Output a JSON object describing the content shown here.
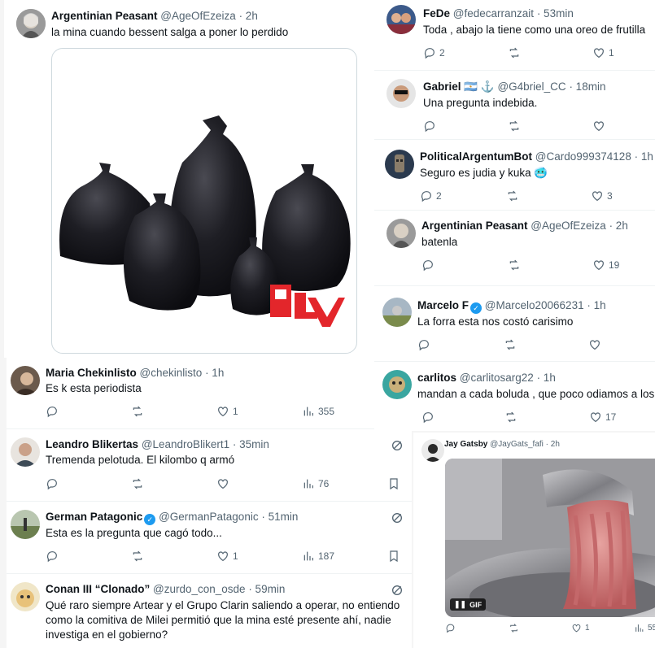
{
  "colors": {
    "text": "#0f1419",
    "muted": "#536471",
    "accent": "#1d9bf0",
    "bag": "#1b1b1f",
    "logo_red": "#e3262b"
  },
  "main": {
    "name": "Argentinian Peasant",
    "handle": "@AgeOfEzeiza",
    "time": "· 2h",
    "text": "la mina cuando bessent salga a poner lo perdido",
    "image_alt": "black garbage bags"
  },
  "left_replies": [
    {
      "name": "Maria Chekinlisto",
      "handle": "@chekinlisto",
      "time": "· 1h",
      "text": "Es k esta periodista",
      "likes": "1",
      "views": "355"
    },
    {
      "name": "Leandro Blikertas",
      "handle": "@LeandroBlikert1",
      "time": "· 35min",
      "text": "Tremenda pelotuda. El kilombo q armó",
      "likes": "",
      "views": "76"
    },
    {
      "name": "German Patagonic",
      "handle": "@GermanPatagonic",
      "time": "· 51min",
      "text": "Esta es la pregunta que cagó todo...",
      "likes": "1",
      "views": "187"
    },
    {
      "name": "Conan III “Clonado”",
      "handle": "@zurdo_con_osde",
      "time": "· 59min",
      "text": "Qué raro siempre Artear y el Grupo Clarin saliendo a operar, no entiendo como la comitiva de Milei permitió que la mina esté presente ahí, nadie investiga en el gobierno?"
    }
  ],
  "right_replies": [
    {
      "name": "FeDe",
      "handle": "@fedecarranzait",
      "time": "· 53min",
      "text": "Toda , abajo la tiene como una oreo de frutilla",
      "replies": "2",
      "likes": "1"
    },
    {
      "name": "Gabriel",
      "flags": "🇦🇷 ⚓",
      "handle": "@G4briel_CC",
      "time": "· 18min",
      "text": "Una pregunta indebida.",
      "replies": "",
      "likes": ""
    },
    {
      "name": "PoliticalArgentumBot",
      "handle": "@Cardo999374128",
      "time": "· 1h",
      "text": "Seguro es judia y kuka",
      "emoji": "🥶",
      "replies": "2",
      "likes": "3"
    },
    {
      "name": "Argentinian Peasant",
      "handle": "@AgeOfEzeiza",
      "time": "· 2h",
      "text": "batenla",
      "replies": "",
      "likes": "19"
    },
    {
      "name": "Marcelo F",
      "handle": "@Marcelo20066231",
      "time": "· 1h",
      "text": "La forra esta nos costó carisimo",
      "replies": "",
      "likes": ""
    },
    {
      "name": "carlitos",
      "handle": "@carlitosarg22",
      "time": "· 1h",
      "text": "mandan a cada boluda , que poco odiamos a los",
      "replies": "",
      "likes": "17"
    }
  ],
  "jay": {
    "name": "Jay Gatsby",
    "handle": "@JayGats_fafi",
    "time": "· 2h",
    "gif_label": "GIF",
    "likes": "1",
    "views": "55"
  }
}
